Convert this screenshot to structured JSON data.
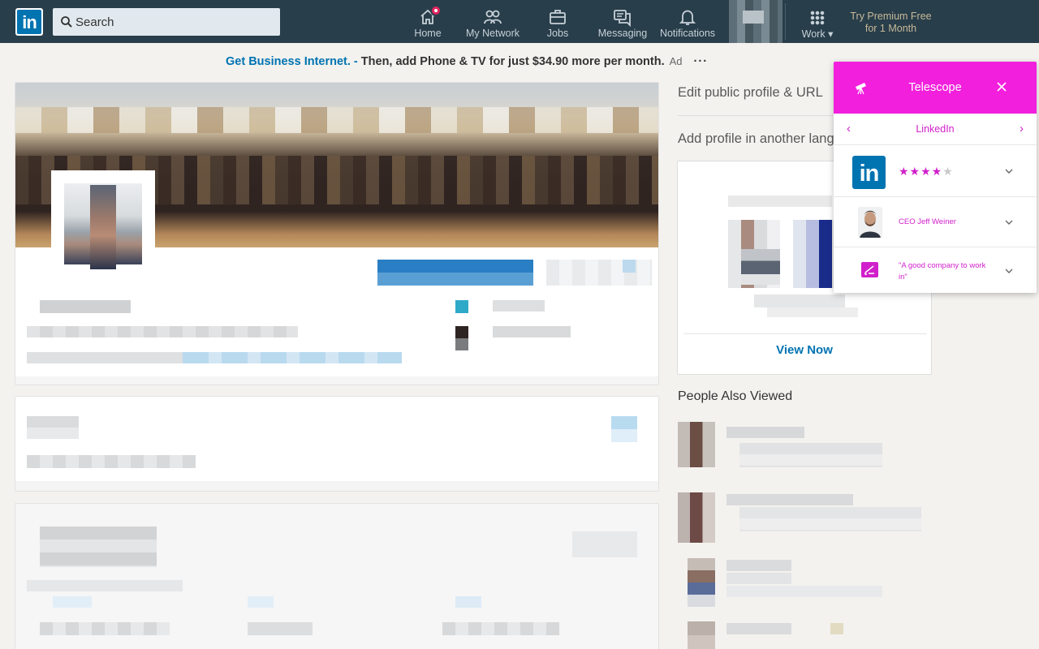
{
  "nav": {
    "search_placeholder": "Search",
    "items": [
      {
        "label": "Home",
        "icon": "home-icon"
      },
      {
        "label": "My Network",
        "icon": "people-icon"
      },
      {
        "label": "Jobs",
        "icon": "briefcase-icon"
      },
      {
        "label": "Messaging",
        "icon": "chat-icon"
      },
      {
        "label": "Notifications",
        "icon": "bell-icon"
      }
    ],
    "work_label": "Work",
    "premium_line1": "Try Premium Free",
    "premium_line2": "for 1 Month",
    "colors": {
      "bar": "#283e4a",
      "brand": "#0073b1",
      "badge": "#e0245e"
    }
  },
  "ad": {
    "brand": "Get Business Internet. -",
    "text": " Then, add Phone & TV for just $34.90 more per month.",
    "tag": "Ad",
    "more": "···"
  },
  "sidebar": {
    "edit_profile": "Edit public profile & URL",
    "add_language": "Add profile in another lang",
    "ad_cta": "View Now",
    "people_also_viewed": "People Also Viewed"
  },
  "telescope": {
    "title": "Telescope",
    "site": "LinkedIn",
    "rating": 4.5,
    "stars_full": "★★★★",
    "stars_half": "★",
    "ceo": "CEO Jeff Weiner",
    "quote": "\"A good company to work in\"",
    "colors": {
      "accent": "#f21fdd",
      "text": "#d11fcb"
    }
  }
}
